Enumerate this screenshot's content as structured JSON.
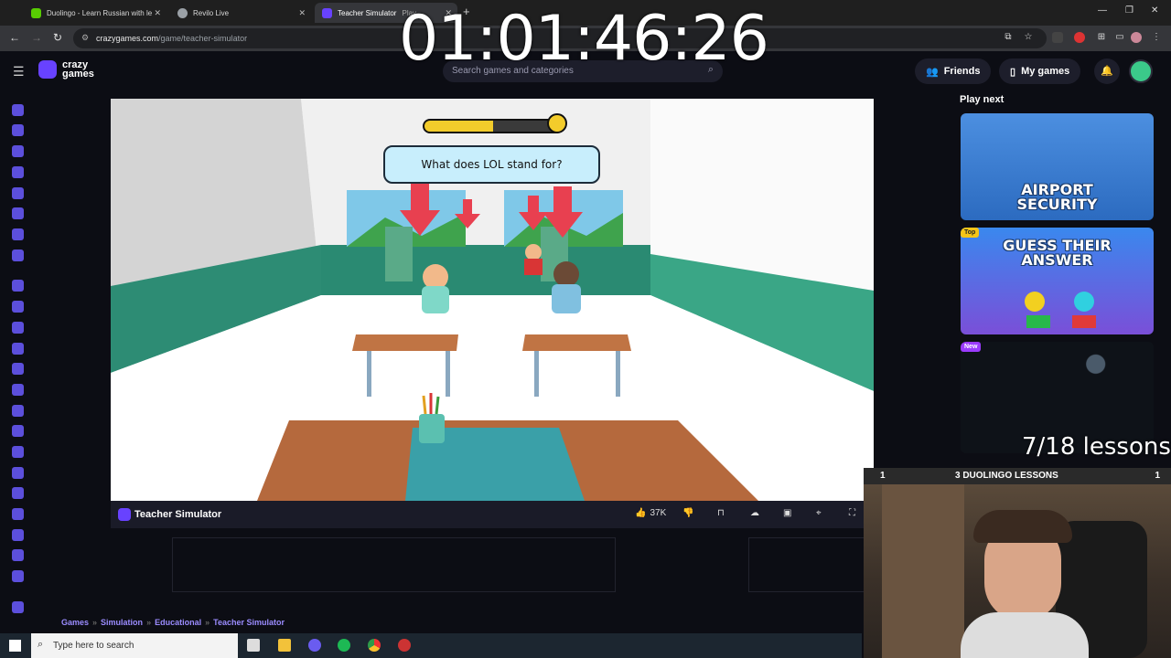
{
  "browser": {
    "tabs": [
      {
        "title": "Duolingo - Learn Russian with le",
        "favicon_color": "#58cc02"
      },
      {
        "title": "Revilo Live",
        "favicon_color": "#9aa0a6"
      },
      {
        "title": "Teacher Simulator",
        "suffix": "Play",
        "favicon_color": "#6842ff"
      }
    ],
    "new_tab_icon": "+",
    "url_host": "crazygames.com",
    "url_path": "/game/teacher-simulator"
  },
  "timer": "01:01:46:26",
  "site": {
    "logo_line1": "crazy",
    "logo_line2": "games",
    "search_placeholder": "Search games and categories",
    "friends_label": "Friends",
    "mygames_label": "My games"
  },
  "game": {
    "title": "Teacher Simulator",
    "question": "What does LOL stand for?",
    "progress_fraction": 0.5,
    "likes": "37K"
  },
  "breadcrumb": [
    "Games",
    "Simulation",
    "Educational",
    "Teacher Simulator"
  ],
  "playnext": {
    "heading": "Play next",
    "cards": [
      {
        "title_line1": "AIRPORT",
        "title_line2": "SECURITY",
        "badge": "",
        "bg": "#3b7bd6"
      },
      {
        "title_line1": "GUESS THEIR",
        "title_line2": "ANSWER",
        "badge": "Top",
        "badge_color": "#f5c518",
        "bg": "#2a76e0"
      },
      {
        "title_line1": "",
        "title_line2": "",
        "badge": "New",
        "badge_color": "#9b3bff",
        "bg": "#0e1218"
      }
    ]
  },
  "stream": {
    "lessons_progress": "7/18 lessons",
    "lesson_bar_left": "1",
    "lesson_bar_title": "3 DUOLINGO LESSONS",
    "lesson_bar_right": "1"
  },
  "taskbar": {
    "search_placeholder": "Type here to search"
  }
}
